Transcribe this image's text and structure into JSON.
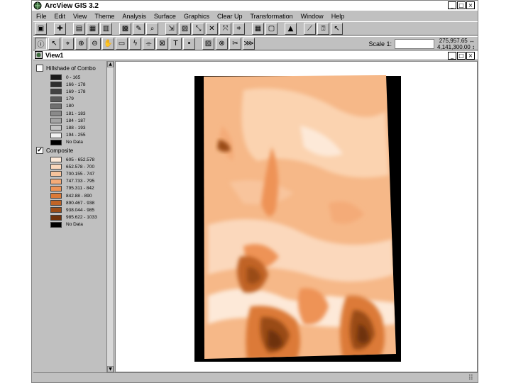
{
  "app": {
    "title": "ArcView GIS 3.2",
    "icon": "arcview-globe-icon"
  },
  "window_controls": {
    "minimize": "_",
    "maximize": "□",
    "close": "×"
  },
  "menu": [
    "File",
    "Edit",
    "View",
    "Theme",
    "Analysis",
    "Surface",
    "Graphics",
    "Clear Up",
    "Transformation",
    "Window",
    "Help"
  ],
  "toolbar": {
    "scale_label": "Scale 1:",
    "scale_value": "",
    "coord_x": "275,957.65",
    "coord_y": "4,141,300.00",
    "coord_x_arrow": "↔",
    "coord_y_arrow": "↕"
  },
  "view": {
    "title": "View1"
  },
  "toc": {
    "themes": [
      {
        "name": "Hillshade of Combo",
        "checked": false,
        "legend": [
          {
            "label": "0 - 165",
            "color": "#1a1a1a"
          },
          {
            "label": "166 - 178",
            "color": "#2e2e2e"
          },
          {
            "label": "169 - 178",
            "color": "#424242"
          },
          {
            "label": "179",
            "color": "#5a5a5a"
          },
          {
            "label": "180",
            "color": "#707070"
          },
          {
            "label": "181 - 183",
            "color": "#8a8a8a"
          },
          {
            "label": "184 - 187",
            "color": "#a4a4a4"
          },
          {
            "label": "188 - 193",
            "color": "#c4c4c4"
          },
          {
            "label": "194 - 255",
            "color": "#f2f2f2"
          },
          {
            "label": "No Data",
            "color": "#000000"
          }
        ]
      },
      {
        "name": "Composite",
        "checked": true,
        "legend": [
          {
            "label": "605 - 652.578",
            "color": "#fde9d8"
          },
          {
            "label": "652.578 - 700",
            "color": "#fbd8bc"
          },
          {
            "label": "700.155 - 747",
            "color": "#f8c49c"
          },
          {
            "label": "747.733 - 795",
            "color": "#f4ab78"
          },
          {
            "label": "795.311 - 842",
            "color": "#ee9356"
          },
          {
            "label": "842.88 - 890",
            "color": "#dc7a38"
          },
          {
            "label": "890.467 - 938",
            "color": "#c06426"
          },
          {
            "label": "938.044 - 985",
            "color": "#9a4c18"
          },
          {
            "label": "985.622 - 1033",
            "color": "#6e320c"
          },
          {
            "label": "No Data",
            "color": "#000000"
          }
        ]
      }
    ]
  },
  "status": {
    "text": ""
  }
}
